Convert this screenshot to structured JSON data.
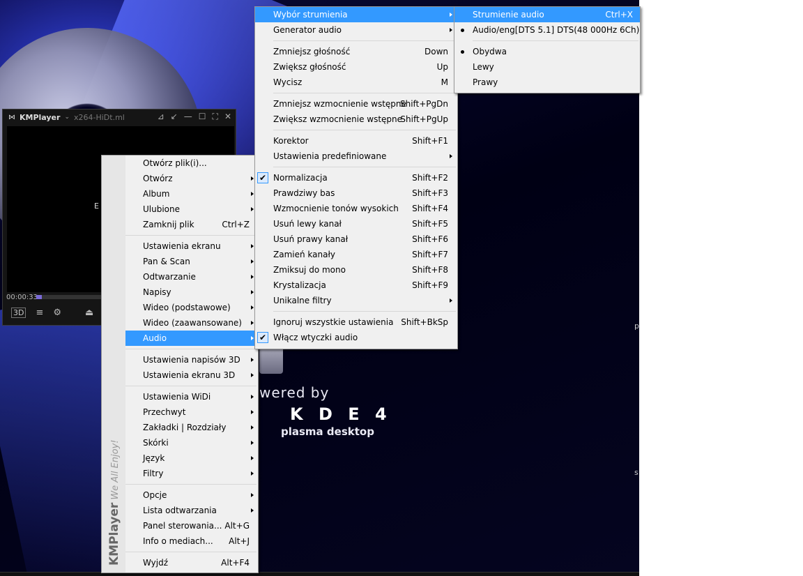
{
  "desktop": {
    "powered_by": "wered by",
    "kde": "K D E 4",
    "plasma": "plasma desktop",
    "edge_p": "p",
    "edge_s": "s"
  },
  "player": {
    "logo": "KMPlayer",
    "filename": "x264-HiDt.ml",
    "title_controls": [
      "⊿",
      "↙",
      "—",
      "☐",
      "⛶",
      "✕"
    ],
    "video_text": "E",
    "time": "00:00:33",
    "seek_progress": 0.03,
    "toolbar": {
      "btn_3d": "3D",
      "list": "≡",
      "settings": "⚙",
      "eject": "⏏",
      "prev": "⏮"
    }
  },
  "main_menu": {
    "brand_name": "KMPlayer",
    "brand_tag": "We All Enjoy!",
    "groups": [
      [
        {
          "label": "Otwórz plik(i)...",
          "shortcut": "",
          "submenu": false
        },
        {
          "label": "Otwórz",
          "shortcut": "",
          "submenu": true
        },
        {
          "label": "Album",
          "shortcut": "",
          "submenu": true
        },
        {
          "label": "Ulubione",
          "shortcut": "",
          "submenu": true
        },
        {
          "label": "Zamknij plik",
          "shortcut": "Ctrl+Z",
          "submenu": false
        }
      ],
      [
        {
          "label": "Ustawienia ekranu",
          "shortcut": "",
          "submenu": true
        },
        {
          "label": "Pan & Scan",
          "shortcut": "",
          "submenu": true
        },
        {
          "label": "Odtwarzanie",
          "shortcut": "",
          "submenu": true
        },
        {
          "label": "Napisy",
          "shortcut": "",
          "submenu": true
        },
        {
          "label": "Wideo (podstawowe)",
          "shortcut": "",
          "submenu": true
        },
        {
          "label": "Wideo (zaawansowane)",
          "shortcut": "",
          "submenu": true
        },
        {
          "label": "Audio",
          "shortcut": "",
          "submenu": true,
          "highlighted": true
        }
      ],
      [
        {
          "label": "Ustawienia napisów 3D",
          "shortcut": "",
          "submenu": true
        },
        {
          "label": "Ustawienia ekranu 3D",
          "shortcut": "",
          "submenu": true
        }
      ],
      [
        {
          "label": "Ustawienia WiDi",
          "shortcut": "",
          "submenu": true
        },
        {
          "label": "Przechwyt",
          "shortcut": "",
          "submenu": true
        },
        {
          "label": "Zakładki | Rozdziały",
          "shortcut": "",
          "submenu": true
        },
        {
          "label": "Skórki",
          "shortcut": "",
          "submenu": true
        },
        {
          "label": "Język",
          "shortcut": "",
          "submenu": true
        },
        {
          "label": "Filtry",
          "shortcut": "",
          "submenu": true
        }
      ],
      [
        {
          "label": "Opcje",
          "shortcut": "",
          "submenu": true
        },
        {
          "label": "Lista odtwarzania",
          "shortcut": "",
          "submenu": true
        },
        {
          "label": "Panel sterowania...",
          "shortcut": "Alt+G",
          "submenu": false
        },
        {
          "label": "Info o mediach...",
          "shortcut": "Alt+J",
          "submenu": false
        }
      ],
      [
        {
          "label": "Wyjdź",
          "shortcut": "Alt+F4",
          "submenu": false
        }
      ]
    ]
  },
  "audio_menu": {
    "groups": [
      [
        {
          "label": "Wybór strumienia",
          "shortcut": "",
          "submenu": true,
          "highlighted": true
        },
        {
          "label": "Generator audio",
          "shortcut": "",
          "submenu": true
        }
      ],
      [
        {
          "label": "Zmniejsz głośność",
          "shortcut": "Down"
        },
        {
          "label": "Zwiększ głośność",
          "shortcut": "Up"
        },
        {
          "label": "Wycisz",
          "shortcut": "M"
        }
      ],
      [
        {
          "label": "Zmniejsz wzmocnienie wstępne",
          "shortcut": "Shift+PgDn"
        },
        {
          "label": "Zwiększ wzmocnienie wstępne",
          "shortcut": "Shift+PgUp"
        }
      ],
      [
        {
          "label": "Korektor",
          "shortcut": "Shift+F1"
        },
        {
          "label": "Ustawienia predefiniowane",
          "shortcut": "",
          "submenu": true
        }
      ],
      [
        {
          "label": "Normalizacja",
          "shortcut": "Shift+F2",
          "checked": true
        },
        {
          "label": "Prawdziwy bas",
          "shortcut": "Shift+F3"
        },
        {
          "label": "Wzmocnienie tonów wysokich",
          "shortcut": "Shift+F4"
        },
        {
          "label": "Usuń lewy kanał",
          "shortcut": "Shift+F5"
        },
        {
          "label": "Usuń prawy kanał",
          "shortcut": "Shift+F6"
        },
        {
          "label": "Zamień kanały",
          "shortcut": "Shift+F7"
        },
        {
          "label": "Zmiksuj do mono",
          "shortcut": "Shift+F8"
        },
        {
          "label": "Krystalizacja",
          "shortcut": "Shift+F9"
        },
        {
          "label": "Unikalne filtry",
          "shortcut": "",
          "submenu": true
        }
      ],
      [
        {
          "label": "Ignoruj wszystkie ustawienia",
          "shortcut": "Shift+BkSp"
        },
        {
          "label": "Włącz wtyczki audio",
          "shortcut": "",
          "checked": true
        }
      ]
    ]
  },
  "stream_menu": {
    "groups": [
      [
        {
          "label": "Strumienie audio",
          "shortcut": "Ctrl+X",
          "highlighted": true
        },
        {
          "label": "Audio/eng[DTS 5.1] DTS(48 000Hz 6Ch)",
          "shortcut": "",
          "radio": true
        }
      ],
      [
        {
          "label": "Obydwa",
          "shortcut": "",
          "radio": true
        },
        {
          "label": "Lewy",
          "shortcut": ""
        },
        {
          "label": "Prawy",
          "shortcut": ""
        }
      ]
    ]
  }
}
